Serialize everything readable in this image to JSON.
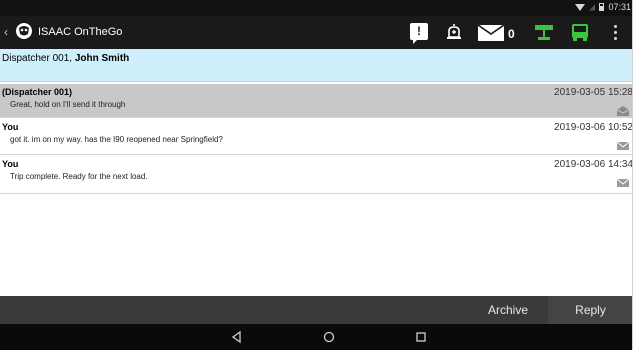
{
  "status_bar": {
    "time": "07:31",
    "icons": [
      "wifi-icon",
      "signal-icon",
      "battery-icon"
    ]
  },
  "app_bar": {
    "title": "ISAAC OnTheGo",
    "unread_count": "0",
    "icons": [
      "back-chevron-icon",
      "app-logo-icon",
      "alert-icon",
      "bell-icon",
      "mail-icon",
      "network-icon",
      "bus-icon",
      "overflow-menu-icon"
    ],
    "colors": {
      "bar": "#1a1a1a",
      "accent_green": "#3cc43c"
    }
  },
  "conversation": {
    "participant_prefix": "Dispatcher 001, ",
    "participant_name": "John Smith",
    "header_bg": "#cfeffd"
  },
  "messages": [
    {
      "sender": "(Dispatcher 001)",
      "text": "Great, hold on I'll send it through",
      "time": "2019-03-05 15:28",
      "status_icon": "mail-open-icon",
      "selected": true
    },
    {
      "sender": "You",
      "text": "got it. im on my way. has the I90 reopened near Springfield?",
      "time": "2019-03-06 10:52",
      "status_icon": "mail-icon",
      "selected": false
    },
    {
      "sender": "You",
      "text": "Trip complete. Ready for the next load.",
      "time": "2019-03-06 14:34",
      "status_icon": "mail-icon",
      "selected": false
    }
  ],
  "actions": {
    "archive_label": "Archive",
    "reply_label": "Reply"
  },
  "nav": {
    "icons": [
      "nav-back-icon",
      "nav-home-icon",
      "nav-recents-icon"
    ]
  }
}
